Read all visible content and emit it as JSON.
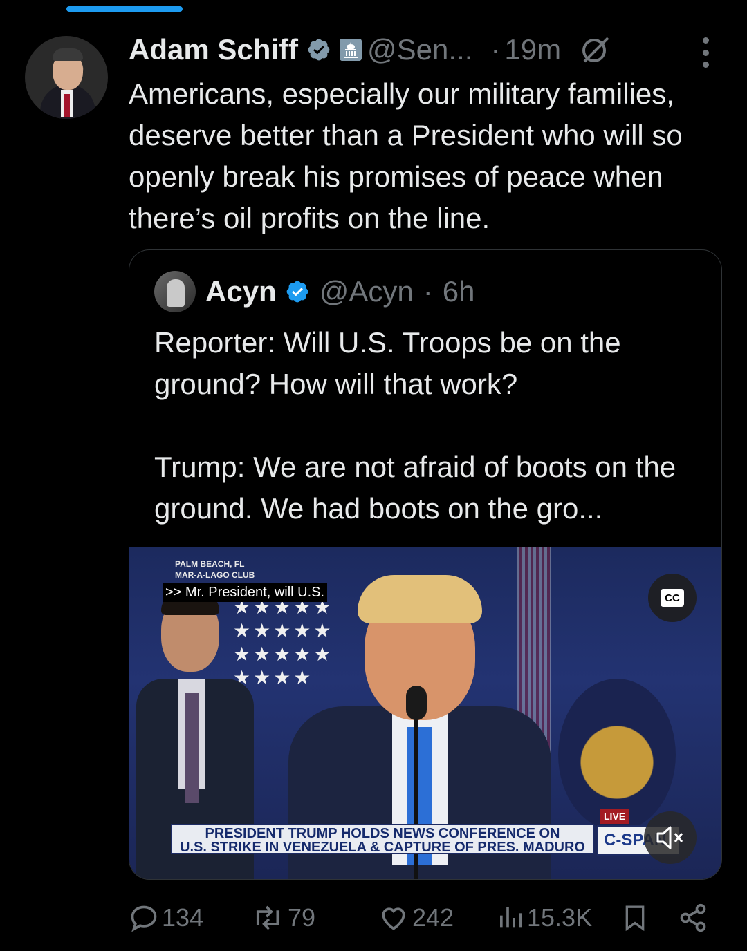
{
  "tweet": {
    "author_name": "Adam Schiff",
    "handle": "@Sen...",
    "separator": "·",
    "time": "19m",
    "text": "Americans, especially our military families, deserve better than a President who will so openly break his promises of peace when there’s oil profits on the line."
  },
  "quote": {
    "author_name": "Acyn",
    "handle": "@Acyn",
    "separator": "·",
    "time": "6h",
    "paragraph_1": "Reporter: Will U.S. Troops be on the ground? How will that work?",
    "paragraph_2": "Trump: We are not afraid of boots on the ground. We had boots on the gro..."
  },
  "video": {
    "location_line_1": "PALM BEACH, FL",
    "location_line_2": "MAR-A-LAGO CLUB",
    "caption": ">> Mr. President, will U.S.",
    "cc_label": "CC",
    "chyron_line_1": "PRESIDENT TRUMP HOLDS NEWS CONFERENCE ON",
    "chyron_line_2": "U.S. STRIKE IN VENEZUELA & CAPTURE OF PRES. MADURO",
    "live_label": "LIVE",
    "network": "C-SPAN"
  },
  "actions": {
    "replies": "134",
    "reposts": "79",
    "likes": "242",
    "views": "15.3K"
  },
  "colors": {
    "background": "#000000",
    "text": "#e7e9ea",
    "muted": "#71767b",
    "accent": "#1d9bf0",
    "border": "#2f3336"
  },
  "icons": [
    "verified-badge-icon",
    "government-building-icon",
    "grok-icon",
    "more-icon",
    "reply-icon",
    "repost-icon",
    "like-icon",
    "views-icon",
    "bookmark-icon",
    "share-icon",
    "cc-icon",
    "mute-icon"
  ]
}
